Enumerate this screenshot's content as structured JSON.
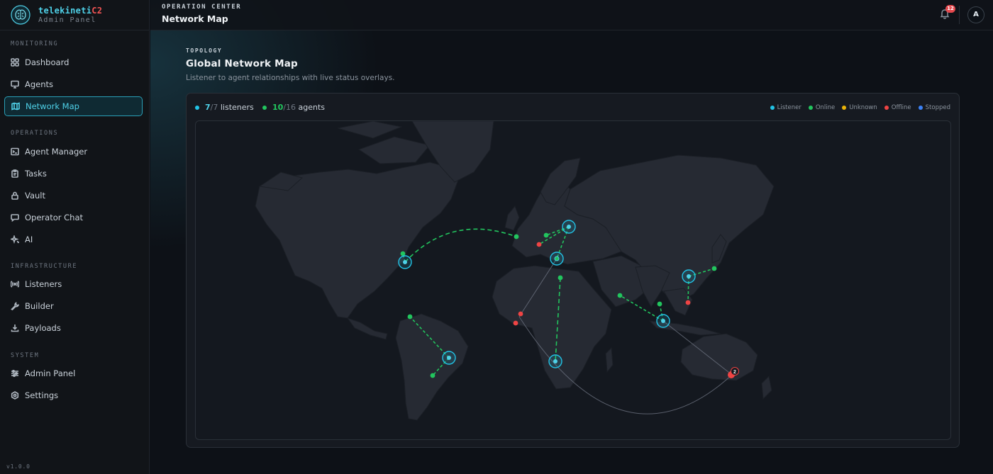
{
  "brand": {
    "name": "telekineti",
    "name_suffix": "C2",
    "subtitle": "Admin Panel"
  },
  "sidebar": {
    "sections": [
      {
        "label": "MONITORING"
      },
      {
        "label": "OPERATIONS"
      },
      {
        "label": "INFRASTRUCTURE"
      },
      {
        "label": "SYSTEM"
      }
    ],
    "items": [
      {
        "label": "Dashboard",
        "icon": "grid-icon"
      },
      {
        "label": "Agents",
        "icon": "monitor-icon"
      },
      {
        "label": "Network Map",
        "icon": "map-icon",
        "active": true
      },
      {
        "label": "Agent Manager",
        "icon": "terminal-icon"
      },
      {
        "label": "Tasks",
        "icon": "clipboard-icon"
      },
      {
        "label": "Vault",
        "icon": "lock-icon"
      },
      {
        "label": "Operator Chat",
        "icon": "chat-icon"
      },
      {
        "label": "AI",
        "icon": "sparkle-icon"
      },
      {
        "label": "Listeners",
        "icon": "radio-icon"
      },
      {
        "label": "Builder",
        "icon": "wrench-icon"
      },
      {
        "label": "Payloads",
        "icon": "download-icon"
      },
      {
        "label": "Admin Panel",
        "icon": "sliders-icon"
      },
      {
        "label": "Settings",
        "icon": "gear-icon"
      }
    ],
    "version": "v1.0.0"
  },
  "header": {
    "kicker": "OPERATION CENTER",
    "title": "Network Map",
    "notifications": "12",
    "avatar": "A"
  },
  "page": {
    "kicker": "TOPOLOGY",
    "title": "Global Network Map",
    "description": "Listener to agent relationships with live status overlays."
  },
  "stats": {
    "listeners": {
      "active": "7",
      "total": "/7",
      "label": "listeners"
    },
    "agents": {
      "active": "10",
      "total": "/16",
      "label": "agents"
    }
  },
  "legend": [
    {
      "label": "Listener",
      "color": "#22c3e6"
    },
    {
      "label": "Online",
      "color": "#22c55e"
    },
    {
      "label": "Unknown",
      "color": "#eab308"
    },
    {
      "label": "Offline",
      "color": "#ef4444"
    },
    {
      "label": "Stopped",
      "color": "#3b82f6"
    }
  ],
  "map": {
    "cluster_count": "2"
  }
}
